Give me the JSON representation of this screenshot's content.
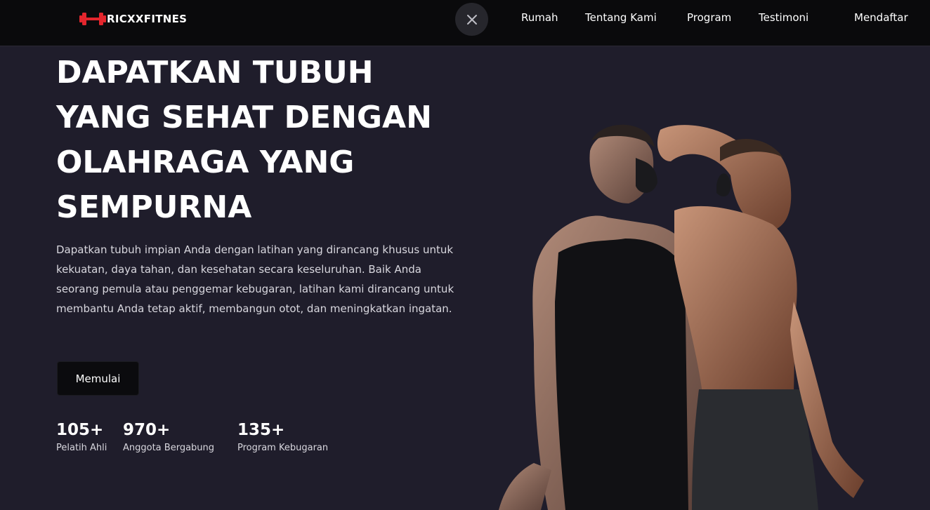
{
  "brand": {
    "name": "RICXXFITNES",
    "accent": "#e3262d"
  },
  "nav": {
    "close_icon": "close-icon",
    "links": [
      "Rumah",
      "Tentang Kami",
      "Program",
      "Testimoni",
      "Mendaftar"
    ]
  },
  "hero": {
    "title": "DAPATKAN TUBUH YANG SEHAT DENGAN OLAHRAGA YANG SEMPURNA",
    "description": "Dapatkan tubuh impian Anda dengan latihan yang dirancang khusus untuk kekuatan, daya tahan, dan kesehatan secara keseluruhan. Baik Anda seorang pemula atau penggemar kebugaran, latihan kami dirancang untuk membantu Anda tetap aktif, membangun otot, dan meningkatkan ingatan.",
    "cta_label": "Memulai",
    "stats": [
      {
        "value": "105+",
        "label": "Pelatih Ahli"
      },
      {
        "value": "970+",
        "label": "Anggota Bergabung"
      },
      {
        "value": "135+",
        "label": "Program Kebugaran"
      }
    ]
  },
  "colors": {
    "background": "#1f1d2b",
    "navbar": "#0a0a0c",
    "button": "#0b0b0e"
  }
}
